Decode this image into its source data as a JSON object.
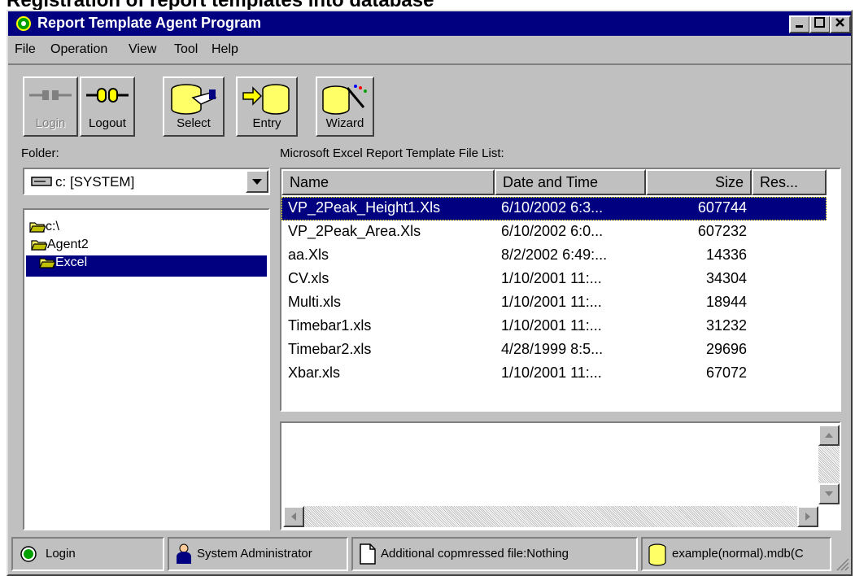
{
  "caption": "Registration of report templates into database",
  "window": {
    "title": "Report Template Agent Program",
    "controls": [
      "minimize",
      "maximize",
      "close"
    ]
  },
  "menu": [
    "File",
    "Operation",
    "View",
    "Tool",
    "Help"
  ],
  "toolbar": {
    "buttons": [
      {
        "label": "Login",
        "icon": "plug-disconnected-icon",
        "enabled": false
      },
      {
        "label": "Logout",
        "icon": "plug-connected-icon",
        "enabled": true
      },
      {
        "label": "Select",
        "icon": "database-hand-icon",
        "enabled": true
      },
      {
        "label": "Entry",
        "icon": "arrow-database-icon",
        "enabled": true
      },
      {
        "label": "Wizard",
        "icon": "database-wand-icon",
        "enabled": true
      }
    ]
  },
  "folder": {
    "label": "Folder:",
    "drive_value": "c: [SYSTEM]",
    "tree": [
      {
        "label": "c:\\",
        "level": 0,
        "selected": false
      },
      {
        "label": "Agent2",
        "level": 1,
        "selected": false
      },
      {
        "label": "Excel",
        "level": 2,
        "selected": true
      }
    ]
  },
  "file_list": {
    "label": "Microsoft Excel Report Template File List:",
    "columns": [
      "Name",
      "Date and Time",
      "Size",
      "Res..."
    ],
    "rows": [
      {
        "name": "VP_2Peak_Height1.Xls",
        "date": "6/10/2002 6:3...",
        "size": "607744",
        "selected": true
      },
      {
        "name": "VP_2Peak_Area.Xls",
        "date": "6/10/2002 6:0...",
        "size": "607232",
        "selected": false
      },
      {
        "name": "aa.Xls",
        "date": "8/2/2002 6:49:...",
        "size": "14336",
        "selected": false
      },
      {
        "name": "CV.xls",
        "date": "1/10/2001 11:...",
        "size": "34304",
        "selected": false
      },
      {
        "name": "Multi.xls",
        "date": "1/10/2001 11:...",
        "size": "18944",
        "selected": false
      },
      {
        "name": "Timebar1.xls",
        "date": "1/10/2001 11:...",
        "size": "31232",
        "selected": false
      },
      {
        "name": "Timebar2.xls",
        "date": "4/28/1999 8:5...",
        "size": "29696",
        "selected": false
      },
      {
        "name": "Xbar.xls",
        "date": "1/10/2001 11:...",
        "size": "67072",
        "selected": false
      }
    ]
  },
  "status_bar": {
    "login": "Login",
    "user": "System Administrator",
    "compressed": "Additional copmressed file:Nothing",
    "database": "example(normal).mdb(C"
  },
  "colors": {
    "title_bar": "#000080",
    "selection": "#000080",
    "face": "#c0c0c0",
    "status_login": "#00a000",
    "database_yellow": "#ffff66"
  }
}
